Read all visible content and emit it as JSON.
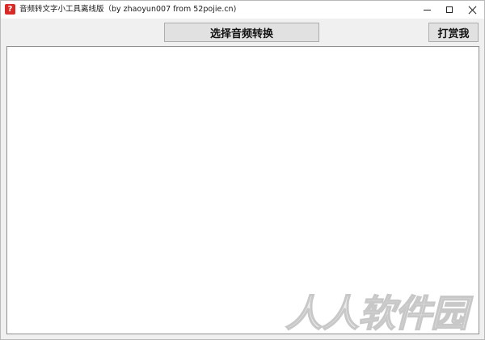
{
  "window": {
    "title": "音频转文字小工具离线版（by zhaoyun007 from 52pojie.cn)",
    "icon": "app-icon",
    "icon_glyph": "?",
    "icon_color": "#d92a25",
    "controls": {
      "minimize": "minimize-icon",
      "maximize": "maximize-icon",
      "close": "close-icon"
    }
  },
  "toolbar": {
    "convert_label": "选择音频转换",
    "donate_label": "打赏我"
  },
  "output": {
    "text": ""
  },
  "watermark": {
    "text": "人人软件园"
  }
}
